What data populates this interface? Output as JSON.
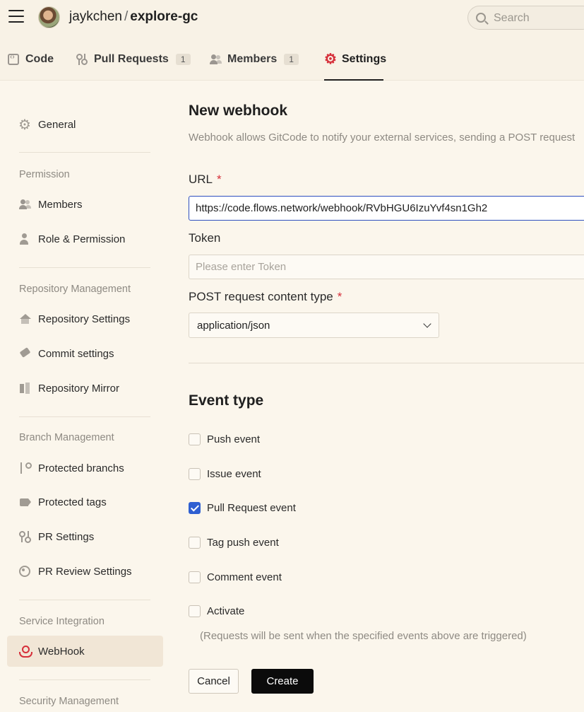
{
  "header": {
    "owner": "jaykchen",
    "separator": "/",
    "repo": "explore-gc",
    "search_placeholder": "Search"
  },
  "tabs": [
    {
      "label": "Code",
      "icon": "code-icon"
    },
    {
      "label": "Pull Requests",
      "count": "1",
      "icon": "pull-request-icon"
    },
    {
      "label": "Members",
      "count": "1",
      "icon": "members-icon"
    },
    {
      "label": "Settings",
      "icon": "gear-icon",
      "active": true
    }
  ],
  "sidebar": {
    "general": "General",
    "groups": {
      "permission": "Permission",
      "repository_management": "Repository Management",
      "branch_management": "Branch Management",
      "service_integration": "Service Integration",
      "security_management": "Security Management"
    },
    "items": {
      "members": "Members",
      "role_permission": "Role & Permission",
      "repository_settings": "Repository Settings",
      "commit_settings": "Commit settings",
      "repository_mirror": "Repository Mirror",
      "protected_branchs": "Protected branchs",
      "protected_tags": "Protected tags",
      "pr_settings": "PR Settings",
      "pr_review_settings": "PR Review Settings",
      "webhook": "WebHook"
    },
    "active_item": "WebHook"
  },
  "form": {
    "title": "New webhook",
    "description": "Webhook allows GitCode to notify your external services, sending a POST request",
    "url_label": "URL",
    "required_mark": "*",
    "url_value": "https://code.flows.network/webhook/RVbHGU6IzuYvf4sn1Gh2",
    "token_label": "Token",
    "token_placeholder": "Please enter Token",
    "content_type_label": "POST request content type",
    "content_type_value": "application/json",
    "event_type_title": "Event type",
    "events": [
      {
        "label": "Push event",
        "checked": false
      },
      {
        "label": "Issue event",
        "checked": false
      },
      {
        "label": "Pull Request event",
        "checked": true
      },
      {
        "label": "Tag push event",
        "checked": false
      },
      {
        "label": "Comment event",
        "checked": false
      },
      {
        "label": "Activate",
        "checked": false
      }
    ],
    "hint": "(Requests will be sent when the specified events above are triggered)",
    "cancel_label": "Cancel",
    "create_label": "Create"
  },
  "colors": {
    "accent_red": "#d62f3a",
    "checkbox_blue": "#2f5fd1",
    "primary_button": "#0b0b0b",
    "background": "#fbf6ec"
  }
}
